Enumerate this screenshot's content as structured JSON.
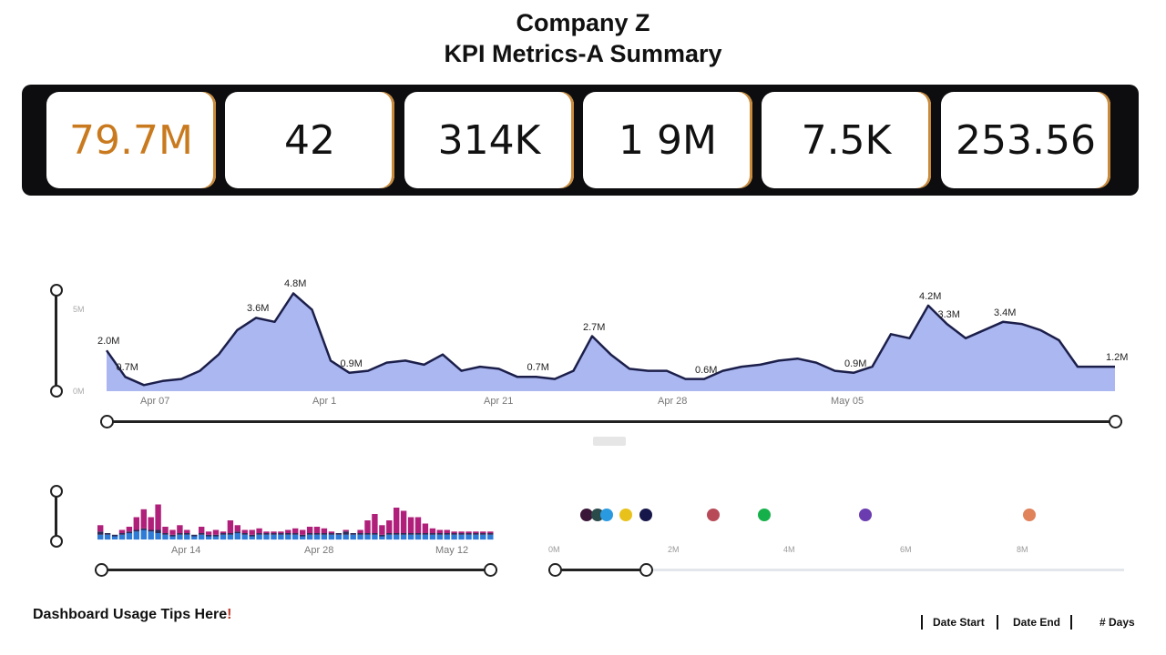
{
  "header": {
    "company": "Company Z",
    "subtitle": "KPI Metrics-A Summary"
  },
  "kpis": [
    "79.7M",
    "42",
    "314K",
    "1 9M",
    "7.5K",
    "253.56"
  ],
  "colors": {
    "kpi_accent": "#c97a1f",
    "area_fill": "#aab7f1",
    "area_line": "#1c1f4a",
    "bar_magenta": "#b0207a",
    "bar_blue": "#2f7bd6",
    "bar_dark": "#2c2c5a"
  },
  "chart_data": [
    {
      "type": "area",
      "x_tick_labels": [
        "Apr 07",
        "Apr 1",
        "Apr 21",
        "Apr 28",
        "May 05"
      ],
      "y_tick_labels": [
        "5M",
        "0M"
      ],
      "ylim": [
        0,
        5
      ],
      "y_unit": "M",
      "values": [
        2.0,
        0.7,
        0.3,
        0.5,
        0.6,
        1.0,
        1.8,
        3.0,
        3.6,
        3.4,
        4.8,
        4.0,
        1.5,
        0.9,
        1.0,
        1.4,
        1.5,
        1.3,
        1.8,
        1.0,
        1.2,
        1.1,
        0.7,
        0.7,
        0.6,
        1.0,
        2.7,
        1.8,
        1.1,
        1.0,
        1.0,
        0.6,
        0.6,
        1.0,
        1.2,
        1.3,
        1.5,
        1.6,
        1.4,
        1.0,
        0.9,
        1.2,
        2.8,
        2.6,
        4.2,
        3.3,
        2.6,
        3.0,
        3.4,
        3.3,
        3.0,
        2.5,
        1.2,
        1.2,
        1.2
      ],
      "point_labels": [
        {
          "index": 0,
          "text": "2.0M"
        },
        {
          "index": 1,
          "text": "0.7M"
        },
        {
          "index": 8,
          "text": "3.6M"
        },
        {
          "index": 10,
          "text": "4.8M"
        },
        {
          "index": 13,
          "text": "0.9M"
        },
        {
          "index": 23,
          "text": "0.7M"
        },
        {
          "index": 26,
          "text": "2.7M"
        },
        {
          "index": 32,
          "text": "0.6M"
        },
        {
          "index": 40,
          "text": "0.9M"
        },
        {
          "index": 44,
          "text": "4.2M"
        },
        {
          "index": 45,
          "text": "3.3M"
        },
        {
          "index": 48,
          "text": "3.4M"
        },
        {
          "index": 54,
          "text": "1.2M"
        }
      ]
    },
    {
      "type": "bar",
      "stacked": true,
      "x_tick_labels": [
        "Apr 14",
        "Apr 28",
        "May 12"
      ],
      "series": [
        {
          "values": [
            3,
            3,
            2,
            3,
            4,
            5,
            6,
            5,
            4,
            3,
            2,
            3,
            3,
            2,
            3,
            2,
            2,
            3,
            3,
            4,
            3,
            2,
            3,
            3,
            3,
            3,
            3,
            3,
            2,
            3,
            3,
            3,
            3,
            3,
            3,
            3,
            3,
            3,
            3,
            2,
            3,
            3,
            3,
            3,
            3,
            3,
            3,
            3,
            3,
            3,
            3,
            3,
            3,
            3,
            3
          ]
        },
        {
          "values": [
            2,
            1,
            1,
            1,
            1,
            1,
            1,
            1,
            2,
            1,
            1,
            1,
            1,
            1,
            1,
            1,
            1,
            1,
            1,
            1,
            1,
            1,
            1,
            1,
            1,
            1,
            1,
            1,
            1,
            1,
            1,
            1,
            1,
            1,
            2,
            1,
            1,
            1,
            1,
            1,
            1,
            1,
            1,
            1,
            1,
            1,
            1,
            1,
            1,
            1,
            1,
            1,
            1,
            1,
            1
          ]
        },
        {
          "values": [
            4,
            0,
            0,
            2,
            3,
            8,
            12,
            8,
            16,
            4,
            3,
            5,
            2,
            0,
            4,
            2,
            3,
            1,
            8,
            4,
            2,
            3,
            3,
            1,
            1,
            1,
            2,
            3,
            3,
            4,
            4,
            3,
            1,
            0,
            1,
            0,
            2,
            8,
            12,
            6,
            8,
            16,
            14,
            10,
            10,
            6,
            3,
            2,
            2,
            1,
            1,
            1,
            1,
            1,
            1
          ]
        }
      ]
    },
    {
      "type": "scatter",
      "x_tick_labels": [
        "0M",
        "2M",
        "4M",
        "6M",
        "8M"
      ],
      "xlim": [
        0,
        8
      ],
      "points": [
        {
          "x": 0.25,
          "color": "#3a1638"
        },
        {
          "x": 0.45,
          "color": "#2b4a4a"
        },
        {
          "x": 0.62,
          "color": "#2a9ae0"
        },
        {
          "x": 0.95,
          "color": "#e8c21a"
        },
        {
          "x": 1.3,
          "color": "#16164a"
        },
        {
          "x": 2.5,
          "color": "#b84a58"
        },
        {
          "x": 3.4,
          "color": "#16b04a"
        },
        {
          "x": 5.2,
          "color": "#6a3cb0"
        },
        {
          "x": 8.1,
          "color": "#e0825a"
        }
      ]
    }
  ],
  "footer": {
    "tips_label": "Dashboard Usage Tips Here",
    "tips_mark": "!",
    "date_start": "Date Start",
    "date_end": "Date End",
    "days": "# Days"
  }
}
